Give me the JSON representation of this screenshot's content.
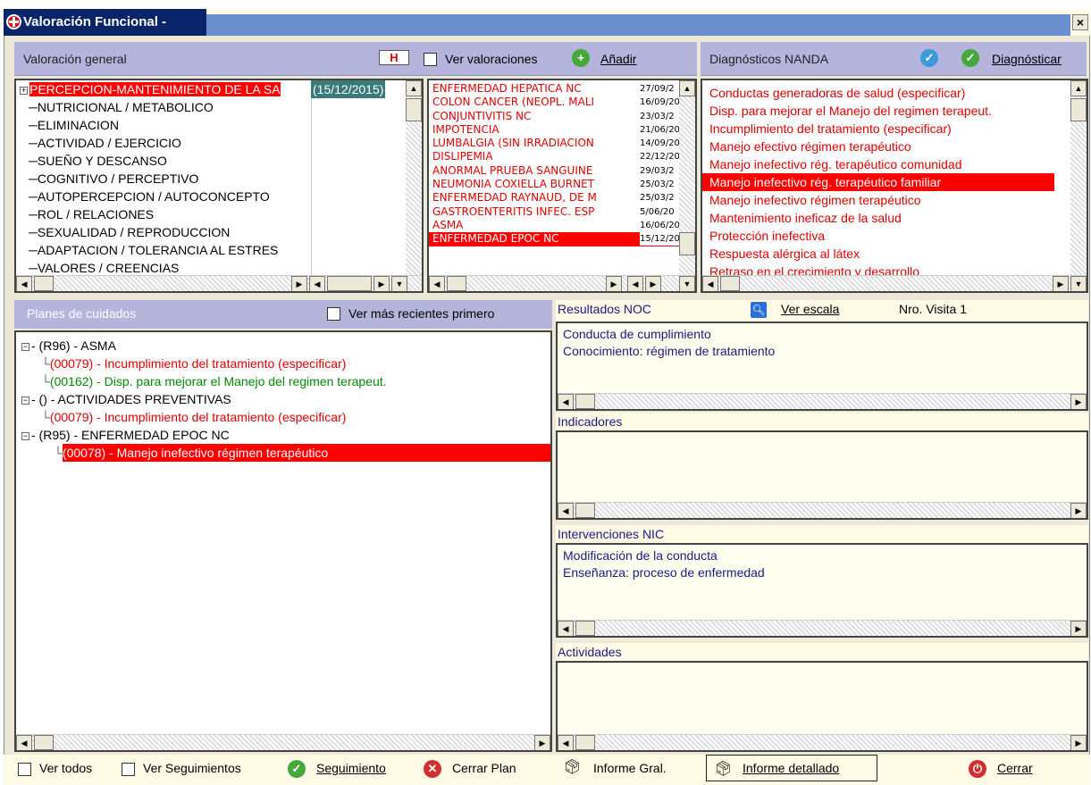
{
  "window": {
    "title": "Valoración Functional -",
    "title_display": "Valoración Funcional -",
    "close": "×"
  },
  "left_panel": {
    "header": "Valoración general",
    "h_icon": "H",
    "ver_valoraciones": "Ver valoraciones",
    "anadir": "Añadir",
    "categories": [
      {
        "label": "PERCEPCION-MANTENIMIENTO DE LA SA",
        "date": "(15/12/2015)",
        "selected": true
      },
      {
        "label": "NUTRICIONAL / METABOLICO"
      },
      {
        "label": "ELIMINACION"
      },
      {
        "label": "ACTIVIDAD / EJERCICIO"
      },
      {
        "label": "SUEÑO Y DESCANSO"
      },
      {
        "label": "COGNITIVO / PERCEPTIVO"
      },
      {
        "label": "AUTOPERCEPCION / AUTOCONCEPTO"
      },
      {
        "label": "ROL / RELACIONES"
      },
      {
        "label": "SEXUALIDAD / REPRODUCCION"
      },
      {
        "label": "ADAPTACION / TOLERANCIA AL ESTRES"
      },
      {
        "label": "VALORES / CREENCIAS"
      }
    ]
  },
  "problems": [
    {
      "name": "ENFERMEDAD HEPATICA NC",
      "date": "27/09/2"
    },
    {
      "name": "COLON CANCER (NEOPL. MALI",
      "date": "16/09/20"
    },
    {
      "name": "CONJUNTIVITIS NC",
      "date": "23/03/2"
    },
    {
      "name": "IMPOTENCIA",
      "date": "21/06/20"
    },
    {
      "name": "LUMBALGIA (SIN IRRADIACION",
      "date": "14/09/20"
    },
    {
      "name": "DISLIPEMIA",
      "date": "22/12/20"
    },
    {
      "name": "ANORMAL PRUEBA SANGUINE",
      "date": "29/03/2"
    },
    {
      "name": "NEUMONIA COXIELLA BURNET",
      "date": "25/03/2"
    },
    {
      "name": "ENFERMEDAD RAYNAUD, DE M",
      "date": "25/03/2"
    },
    {
      "name": "GASTROENTERITIS INFEC. ESP",
      "date": "5/06/20"
    },
    {
      "name": "ASMA",
      "date": "16/06/20"
    },
    {
      "name": "ENFERMEDAD EPOC NC",
      "date": "15/12/20",
      "selected": true
    }
  ],
  "nanda": {
    "header": "Diagnósticos NANDA",
    "diagnosticar": "Diagnósticar",
    "items": [
      {
        "label": "Conductas generadoras de salud (especificar)"
      },
      {
        "label": "Disp. para mejorar el Manejo del regimen terapeut."
      },
      {
        "label": "Incumplimiento del tratamiento (especificar)"
      },
      {
        "label": "Manejo efectivo régimen terapéutico"
      },
      {
        "label": "Manejo inefectivo rég. terapéutico comunidad"
      },
      {
        "label": "Manejo inefectivo rég. terapéutico familiar",
        "selected": true
      },
      {
        "label": "Manejo inefectivo régimen terapéutico"
      },
      {
        "label": "Mantenimiento ineficaz de la salud"
      },
      {
        "label": "Protección inefectiva"
      },
      {
        "label": "Respuesta alérgica al látex"
      },
      {
        "label": "Retraso en el crecimiento y desarrollo"
      }
    ]
  },
  "planes": {
    "header": "Planes de cuidados",
    "recientes": "Ver más recientes primero",
    "tree": [
      {
        "text": "(R96) - ASMA",
        "level": 0,
        "color": "black"
      },
      {
        "text": "(00079) - Incumplimiento del tratamiento (especificar)",
        "level": 1,
        "color": "red"
      },
      {
        "text": "(00162) - Disp. para mejorar el Manejo del regimen terapeut.",
        "level": 1,
        "color": "green"
      },
      {
        "text": "() - ACTIVIDADES PREVENTIVAS",
        "level": 0,
        "color": "black"
      },
      {
        "text": "(00079) - Incumplimiento del tratamiento (especificar)",
        "level": 1,
        "color": "red"
      },
      {
        "text": "(R95) - ENFERMEDAD EPOC NC",
        "level": 0,
        "color": "black"
      },
      {
        "text": "(00078) - Manejo inefectivo régimen terapéutico",
        "level": 1,
        "color": "selected"
      }
    ]
  },
  "noc": {
    "label": "Resultados NOC",
    "ver_escala": "Ver escala",
    "visita": "Nro. Visita 1",
    "items": [
      "Conducta de cumplimiento",
      "Conocimiento: régimen de tratamiento"
    ]
  },
  "indicadores": {
    "label": "Indicadores"
  },
  "nic": {
    "label": "Intervenciones NIC",
    "items": [
      "Modificación de la conducta",
      "Enseñanza: proceso de enfermedad"
    ]
  },
  "actividades": {
    "label": "Actividades"
  },
  "bottom": {
    "ver_todos": "Ver todos",
    "ver_seguimientos": "Ver Seguimientos",
    "seguimiento": "Seguimiento",
    "cerrar_plan": "Cerrar Plan",
    "informe_gral": "Informe Gral.",
    "informe_detallado": "Informe detallado",
    "cerrar": "Cerrar"
  }
}
